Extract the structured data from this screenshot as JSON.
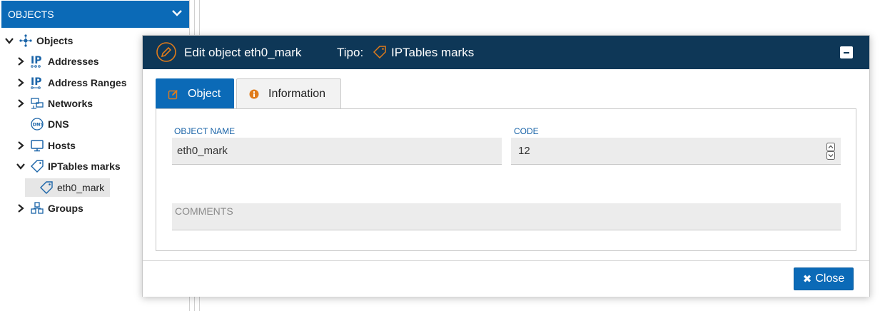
{
  "left_panel": {
    "header_title": "OBJECTS",
    "tree": {
      "root_label": "Objects",
      "items": [
        {
          "label": "Addresses",
          "icon": "ip-address-icon"
        },
        {
          "label": "Address Ranges",
          "icon": "ip-range-icon"
        },
        {
          "label": "Networks",
          "icon": "network-icon"
        },
        {
          "label": "DNS",
          "icon": "dns-icon"
        },
        {
          "label": "Hosts",
          "icon": "monitor-icon"
        },
        {
          "label": "IPTables marks",
          "icon": "tag-icon",
          "children": [
            {
              "label": "eth0_mark",
              "icon": "tag-icon"
            }
          ]
        },
        {
          "label": "Groups",
          "icon": "groups-icon"
        }
      ]
    }
  },
  "dialog": {
    "title": "Edit object eth0_mark",
    "tipo_label": "Tipo:",
    "tipo_value": "IPTables marks",
    "tabs": [
      {
        "label": "Object",
        "icon": "edit-square-icon",
        "active": true
      },
      {
        "label": "Information",
        "icon": "info-circle-icon",
        "active": false
      }
    ],
    "form": {
      "object_name_label": "OBJECT NAME",
      "object_name_value": "eth0_mark",
      "code_label": "CODE",
      "code_value": "12",
      "comments_placeholder": "COMMENTS"
    },
    "close_label": "Close",
    "colors": {
      "header_bg": "#0e3757",
      "accent": "#0b6ab7",
      "icon_orange": "#e07b1a"
    }
  }
}
